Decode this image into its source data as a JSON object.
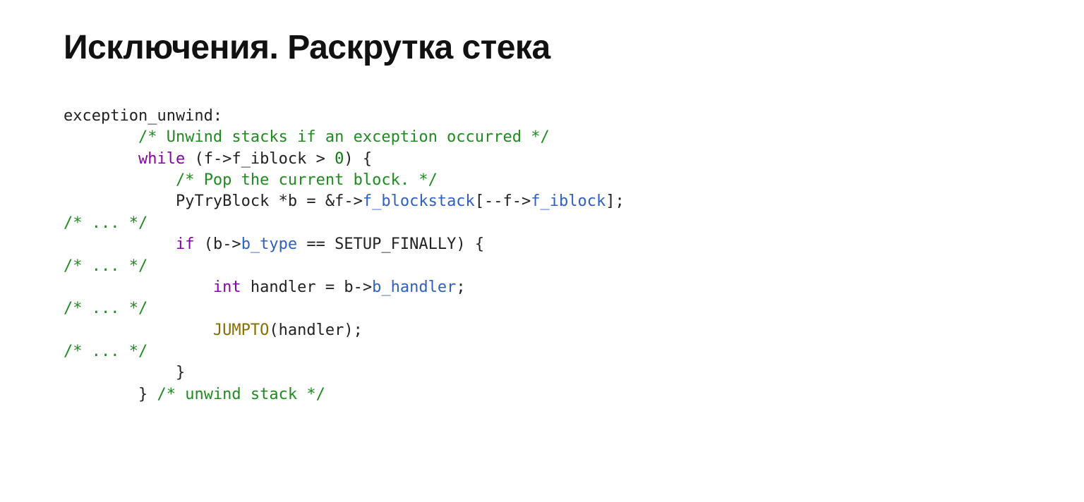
{
  "slide": {
    "title": "Исключения. Раскрутка стека"
  },
  "code": {
    "l0_label": "exception_unwind:",
    "l1_indent": "        ",
    "l1_comment": "/* Unwind stacks if an exception occurred */",
    "l2_indent": "        ",
    "l2_kw": "while",
    "l2_mid": " (f->f_iblock > ",
    "l2_lit": "0",
    "l2_tail": ") {",
    "l3_indent": "            ",
    "l3_comment": "/* Pop the current block. */",
    "l4_indent": "            ",
    "l4_a": "PyTryBlock *b = &f->",
    "l4_m1": "f_blockstack",
    "l4_b": "[--f->",
    "l4_m2": "f_iblock",
    "l4_c": "];",
    "l5_comment": "/* ... */",
    "l6_indent": "            ",
    "l6_kw": "if",
    "l6_a": " (b->",
    "l6_m": "b_type",
    "l6_b": " == SETUP_FINALLY) {",
    "l7_comment": "/* ... */",
    "l8_indent": "                ",
    "l8_kw": "int",
    "l8_a": " handler = b->",
    "l8_m": "b_handler",
    "l8_b": ";",
    "l9_comment": "/* ... */",
    "l10_indent": "                ",
    "l10_fn": "JUMPTO",
    "l10_tail": "(handler);",
    "l11_comment": "/* ... */",
    "l12_indent": "            ",
    "l12_body": "}",
    "l13_indent": "        ",
    "l13_body": "} ",
    "l13_comment": "/* unwind stack */"
  }
}
